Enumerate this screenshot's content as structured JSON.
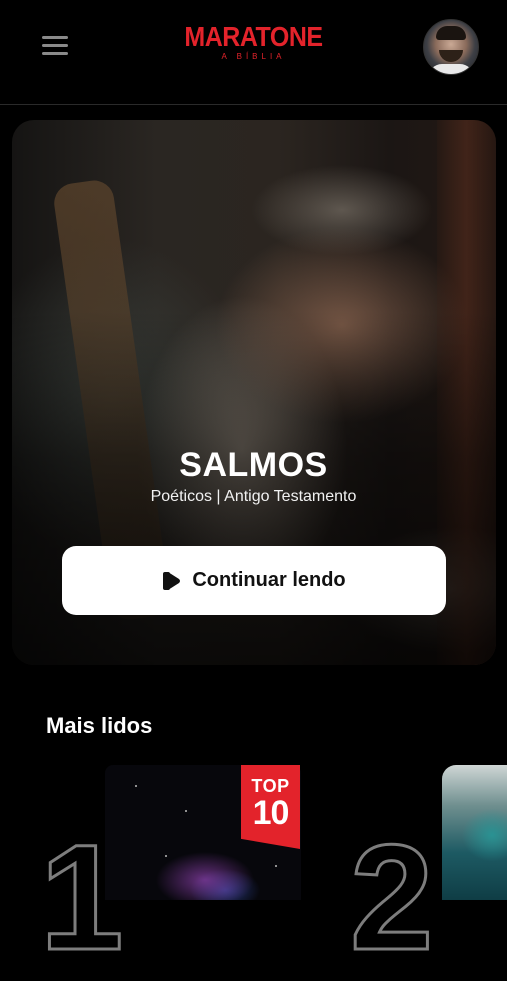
{
  "header": {
    "logo_main": "MARATONE",
    "logo_sub": "A BÍBLIA",
    "menu_icon": "hamburger-menu-icon",
    "avatar_icon": "user-avatar"
  },
  "featured": {
    "title": "SALMOS",
    "subtitle": "Poéticos | Antigo Testamento",
    "button_label": "Continuar lendo",
    "button_icon": "play-icon"
  },
  "most_read": {
    "title": "Mais lidos",
    "items": [
      {
        "rank": "1",
        "badge_top": "TOP",
        "badge_num": "10"
      },
      {
        "rank": "2"
      }
    ]
  },
  "colors": {
    "brand": "#e3232b",
    "background": "#000000",
    "button_bg": "#ffffff"
  }
}
